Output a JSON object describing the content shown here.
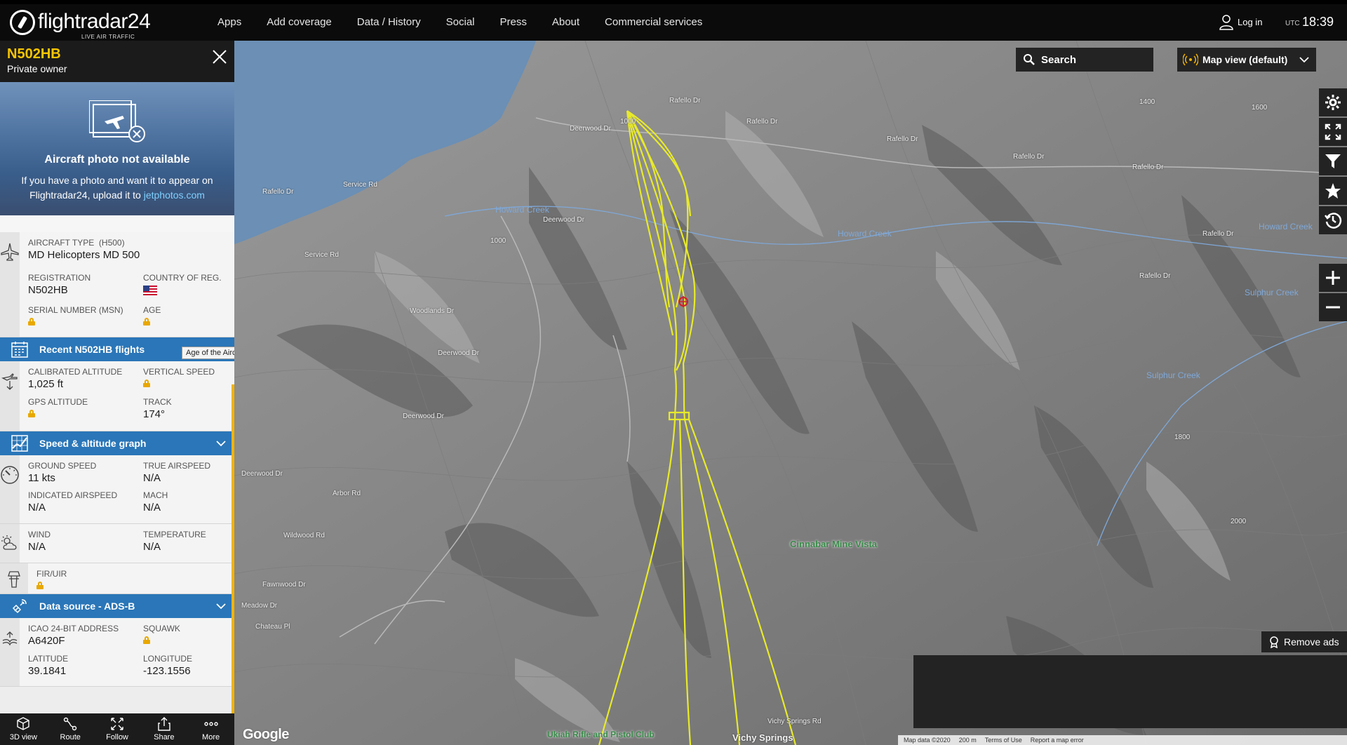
{
  "topbar": {
    "logo_name": "flightradar24",
    "logo_tag": "LIVE AIR TRAFFIC",
    "nav": [
      "Apps",
      "Add coverage",
      "Data / History",
      "Social",
      "Press",
      "About",
      "Commercial services"
    ],
    "login": "Log in",
    "utc_label": "UTC",
    "time": "18:39"
  },
  "flight": {
    "callsign": "N502HB",
    "owner": "Private owner"
  },
  "photo": {
    "title": "Aircraft photo not available",
    "message": "If you have a photo and want it to appear on Flightradar24, upload it to",
    "link": "jetphotos.com"
  },
  "aircraft": {
    "type_label": "AIRCRAFT TYPE",
    "type_code": "(H500)",
    "type_value": "MD Helicopters MD 500",
    "registration_label": "REGISTRATION",
    "registration_value": "N502HB",
    "country_label": "COUNTRY OF REG.",
    "serial_label": "SERIAL NUMBER (MSN)",
    "age_label": "AGE"
  },
  "recent_bar": "Recent N502HB flights",
  "tooltip": "Age of the Aircraft",
  "altitude": {
    "calibrated_label": "CALIBRATED ALTITUDE",
    "calibrated_value": "1,025 ft",
    "vertical_label": "VERTICAL SPEED",
    "gps_label": "GPS ALTITUDE",
    "track_label": "TRACK",
    "track_value": "174°"
  },
  "graph_bar": "Speed & altitude graph",
  "speed": {
    "ground_label": "GROUND SPEED",
    "ground_value": "11 kts",
    "true_label": "TRUE AIRSPEED",
    "true_value": "N/A",
    "indicated_label": "INDICATED AIRSPEED",
    "indicated_value": "N/A",
    "mach_label": "MACH",
    "mach_value": "N/A"
  },
  "weather": {
    "wind_label": "WIND",
    "wind_value": "N/A",
    "temp_label": "TEMPERATURE",
    "temp_value": "N/A"
  },
  "fir": {
    "label": "FIR/UIR"
  },
  "source_bar": "Data source - ADS-B",
  "adsb": {
    "icao_label": "ICAO 24-BIT ADDRESS",
    "icao_value": "A6420F",
    "squawk_label": "SQUAWK",
    "lat_label": "LATITUDE",
    "lat_value": "39.1841",
    "lon_label": "LONGITUDE",
    "lon_value": "-123.1556"
  },
  "bottombar": [
    "3D view",
    "Route",
    "Follow",
    "Share",
    "More"
  ],
  "map": {
    "search": "Search",
    "map_view": "Map view (default)",
    "remove_ads": "Remove ads",
    "google": "Google",
    "attribution": [
      "Map data ©2020",
      "200 m",
      "Terms of Use",
      "Report a map error"
    ],
    "roads": [
      "Deerwood Dr",
      "Rafello Dr",
      "Rafello Dr",
      "Rafello Dr",
      "Rafello Dr",
      "Rafello Dr",
      "Rafello Dr",
      "Rafello Dr",
      "Rafello Dr",
      "Service Rd",
      "Service Rd",
      "Deerwood Dr",
      "Deerwood Dr",
      "Deerwood Dr",
      "Deerwood Dr",
      "Woodlands Dr",
      "Wildwood Rd",
      "Fawnwood Dr",
      "Chateau Pl",
      "Meadow Dr",
      "Arbor Rd",
      "Vichy Springs Rd",
      "1000",
      "1000",
      "1400",
      "1600",
      "1800",
      "2000"
    ],
    "creeks": [
      "Howard Creek",
      "Howard Creek",
      "Howard Creek",
      "Sulphur Creek",
      "Sulphur Creek"
    ],
    "pois": [
      "Cinnabar Mine Vista",
      "Ukiah Rifle and Pistol Club",
      "Vichy Springs"
    ],
    "colors": {
      "track": "#e8ea2a",
      "water": "#6b8fb5",
      "panel_bar": "#2a76b8",
      "accent": "#f2b400"
    }
  }
}
